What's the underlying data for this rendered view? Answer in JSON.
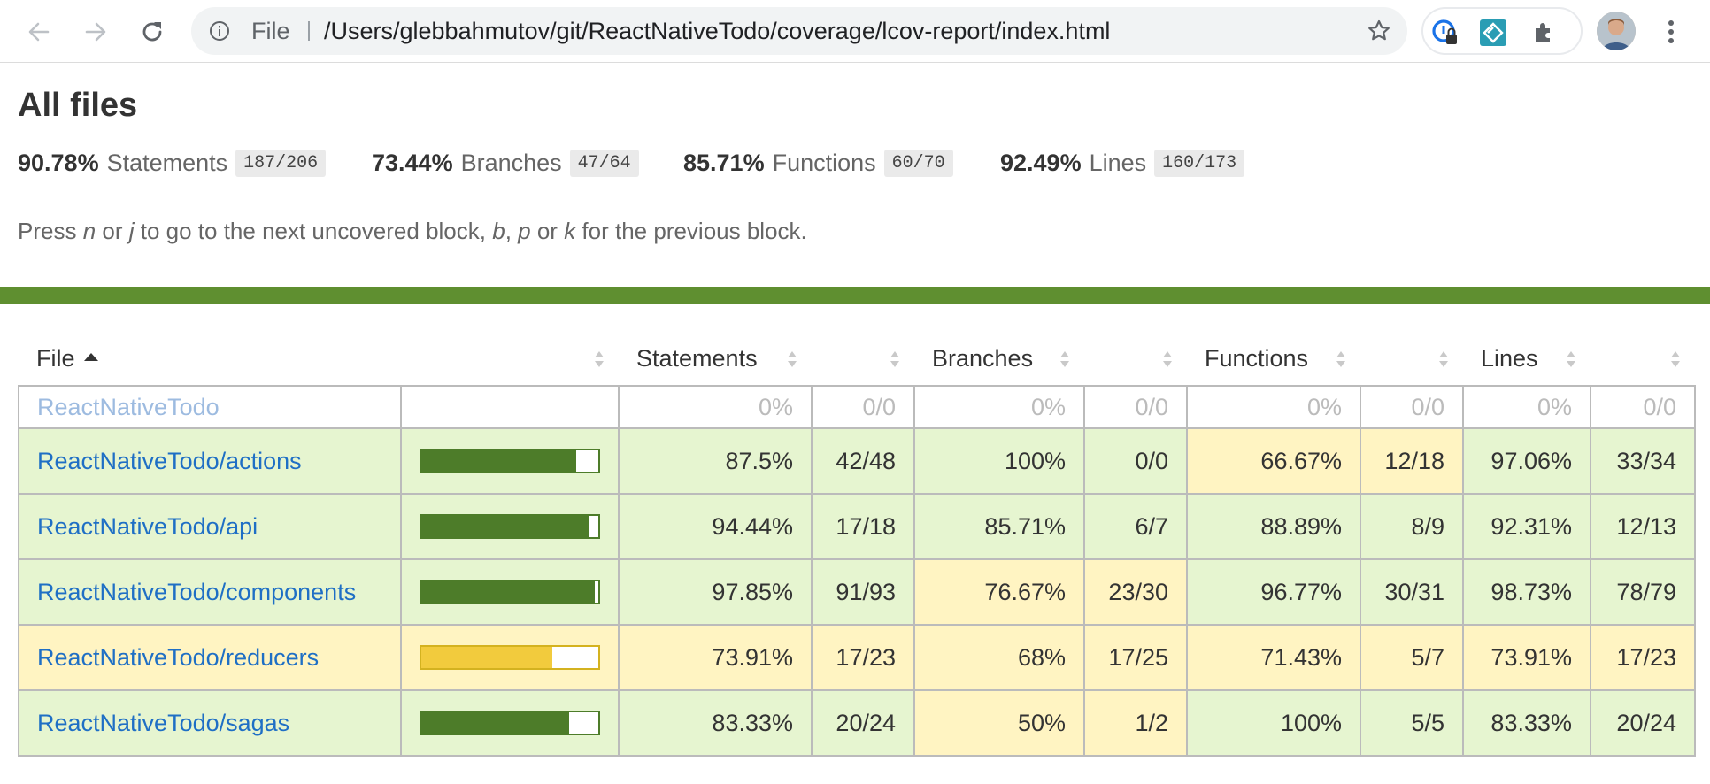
{
  "browser": {
    "scheme_label": "File",
    "url": "/Users/glebbahmutov/git/ReactNativeTodo/coverage/lcov-report/index.html",
    "icons": [
      "back-arrow-icon",
      "forward-arrow-icon",
      "reload-icon",
      "info-icon",
      "star-icon",
      "password-manager-extension-icon",
      "extension-icon",
      "puzzle-extensions-icon",
      "profile-avatar",
      "kebab-menu-icon"
    ]
  },
  "report": {
    "title": "All files",
    "summary": [
      {
        "pct": "90.78%",
        "label": "Statements",
        "fraction": "187/206"
      },
      {
        "pct": "73.44%",
        "label": "Branches",
        "fraction": "47/64"
      },
      {
        "pct": "85.71%",
        "label": "Functions",
        "fraction": "60/70"
      },
      {
        "pct": "92.49%",
        "label": "Lines",
        "fraction": "160/173"
      }
    ],
    "hint": {
      "t1": "Press ",
      "k1": "n",
      "t2": " or ",
      "k2": "j",
      "t3": " to go to the next uncovered block, ",
      "k3": "b",
      "t4": ", ",
      "k4": "p",
      "t5": " or ",
      "k5": "k",
      "t6": " for the previous block."
    },
    "status_color": "#5f8f30"
  },
  "table": {
    "headers": {
      "file": "File",
      "statements": "Statements",
      "branches": "Branches",
      "functions": "Functions",
      "lines": "Lines"
    },
    "colors": {
      "high": "#e6f5d0",
      "medium": "#fff4c2",
      "bar_high": "#4d7c29",
      "bar_medium": "#f2cb3d"
    },
    "rows": [
      {
        "file": "ReactNativeTodo",
        "stmt_pct": "0%",
        "stmt_frac": "0/0",
        "br_pct": "0%",
        "br_frac": "0/0",
        "fn_pct": "0%",
        "fn_frac": "0/0",
        "ln_pct": "0%",
        "ln_frac": "0/0"
      },
      {
        "file": "ReactNativeTodo/actions",
        "stmt_pct": "87.5%",
        "stmt_frac": "42/48",
        "br_pct": "100%",
        "br_frac": "0/0",
        "fn_pct": "66.67%",
        "fn_frac": "12/18",
        "ln_pct": "97.06%",
        "ln_frac": "33/34"
      },
      {
        "file": "ReactNativeTodo/api",
        "stmt_pct": "94.44%",
        "stmt_frac": "17/18",
        "br_pct": "85.71%",
        "br_frac": "6/7",
        "fn_pct": "88.89%",
        "fn_frac": "8/9",
        "ln_pct": "92.31%",
        "ln_frac": "12/13"
      },
      {
        "file": "ReactNativeTodo/components",
        "stmt_pct": "97.85%",
        "stmt_frac": "91/93",
        "br_pct": "76.67%",
        "br_frac": "23/30",
        "fn_pct": "96.77%",
        "fn_frac": "30/31",
        "ln_pct": "98.73%",
        "ln_frac": "78/79"
      },
      {
        "file": "ReactNativeTodo/reducers",
        "stmt_pct": "73.91%",
        "stmt_frac": "17/23",
        "br_pct": "68%",
        "br_frac": "17/25",
        "fn_pct": "71.43%",
        "fn_frac": "5/7",
        "ln_pct": "73.91%",
        "ln_frac": "17/23"
      },
      {
        "file": "ReactNativeTodo/sagas",
        "stmt_pct": "83.33%",
        "stmt_frac": "20/24",
        "br_pct": "50%",
        "br_frac": "1/2",
        "fn_pct": "100%",
        "fn_frac": "5/5",
        "ln_pct": "83.33%",
        "ln_frac": "20/24"
      }
    ]
  }
}
